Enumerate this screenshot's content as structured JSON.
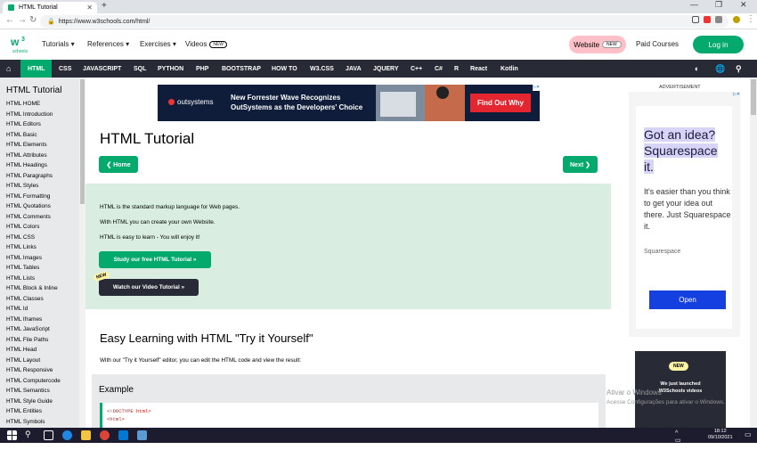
{
  "browser": {
    "tab_title": "HTML Tutorial",
    "url": "https://www.w3schools.com/html/"
  },
  "header": {
    "logo_text": "w3schools",
    "menu": [
      "Tutorials",
      "References",
      "Exercises",
      "Videos"
    ],
    "videos_badge": "NEW",
    "website_label": "Website",
    "website_badge": "NEW",
    "paid_courses": "Paid Courses",
    "login": "Log in"
  },
  "topnav": [
    "HTML",
    "CSS",
    "JAVASCRIPT",
    "SQL",
    "PYTHON",
    "PHP",
    "BOOTSTRAP",
    "HOW TO",
    "W3.CSS",
    "JAVA",
    "JQUERY",
    "C++",
    "C#",
    "R",
    "React",
    "Kotlin"
  ],
  "sidebar": {
    "title": "HTML Tutorial",
    "items": [
      "HTML HOME",
      "HTML Introduction",
      "HTML Editors",
      "HTML Basic",
      "HTML Elements",
      "HTML Attributes",
      "HTML Headings",
      "HTML Paragraphs",
      "HTML Styles",
      "HTML Formatting",
      "HTML Quotations",
      "HTML Comments",
      "HTML Colors",
      "HTML CSS",
      "HTML Links",
      "HTML Images",
      "HTML Tables",
      "HTML Lists",
      "HTML Block & Inline",
      "HTML Classes",
      "HTML Id",
      "HTML Iframes",
      "HTML JavaScript",
      "HTML File Paths",
      "HTML Head",
      "HTML Layout",
      "HTML Responsive",
      "HTML Computercode",
      "HTML Semantics",
      "HTML Style Guide",
      "HTML Entities",
      "HTML Symbols"
    ]
  },
  "ad_top": {
    "brand": "outsystems",
    "message_line1": "New Forrester Wave Recognizes",
    "message_line2": "OutSystems as the Developers' Choice",
    "cta": "Find Out Why"
  },
  "main": {
    "title": "HTML Tutorial",
    "home_button": "❮ Home",
    "next_button": "Next ❯",
    "intro": [
      "HTML is the standard markup language for Web pages.",
      "With HTML you can create your own Website.",
      "HTML is easy to learn - You will enjoy it!"
    ],
    "study_button": "Study our free HTML Tutorial »",
    "new_badge": "NEW",
    "video_button": "Watch our Video Tutorial »",
    "easy_heading": "Easy Learning with HTML \"Try it Yourself\"",
    "easy_text": "With our \"Try it Yourself\" editor, you can edit the HTML code and view the result:",
    "example_title": "Example",
    "code_line1_open": "<!DOCTYPE ",
    "code_line1_kw": "html",
    "code_line1_close": ">",
    "code_line2": "<html>"
  },
  "right": {
    "advertisement": "ADVERTISEMENT",
    "sq_headline_1": "Got an idea?",
    "sq_headline_2": "Squarespace",
    "sq_headline_3": "it.",
    "sq_body": "It's easier than you think to get your idea out there. Just Squarespace it.",
    "sq_brand": "Squarespace",
    "sq_open": "Open",
    "video_new": "NEW",
    "video_text_1": "We just launched",
    "video_text_2": "W3Schools videos"
  },
  "watermark": {
    "line1": "Ativar o Windows",
    "line2": "Acesse Configurações para ativar o Windows."
  },
  "taskbar": {
    "time": "18:12",
    "date": "09/10/2021"
  }
}
